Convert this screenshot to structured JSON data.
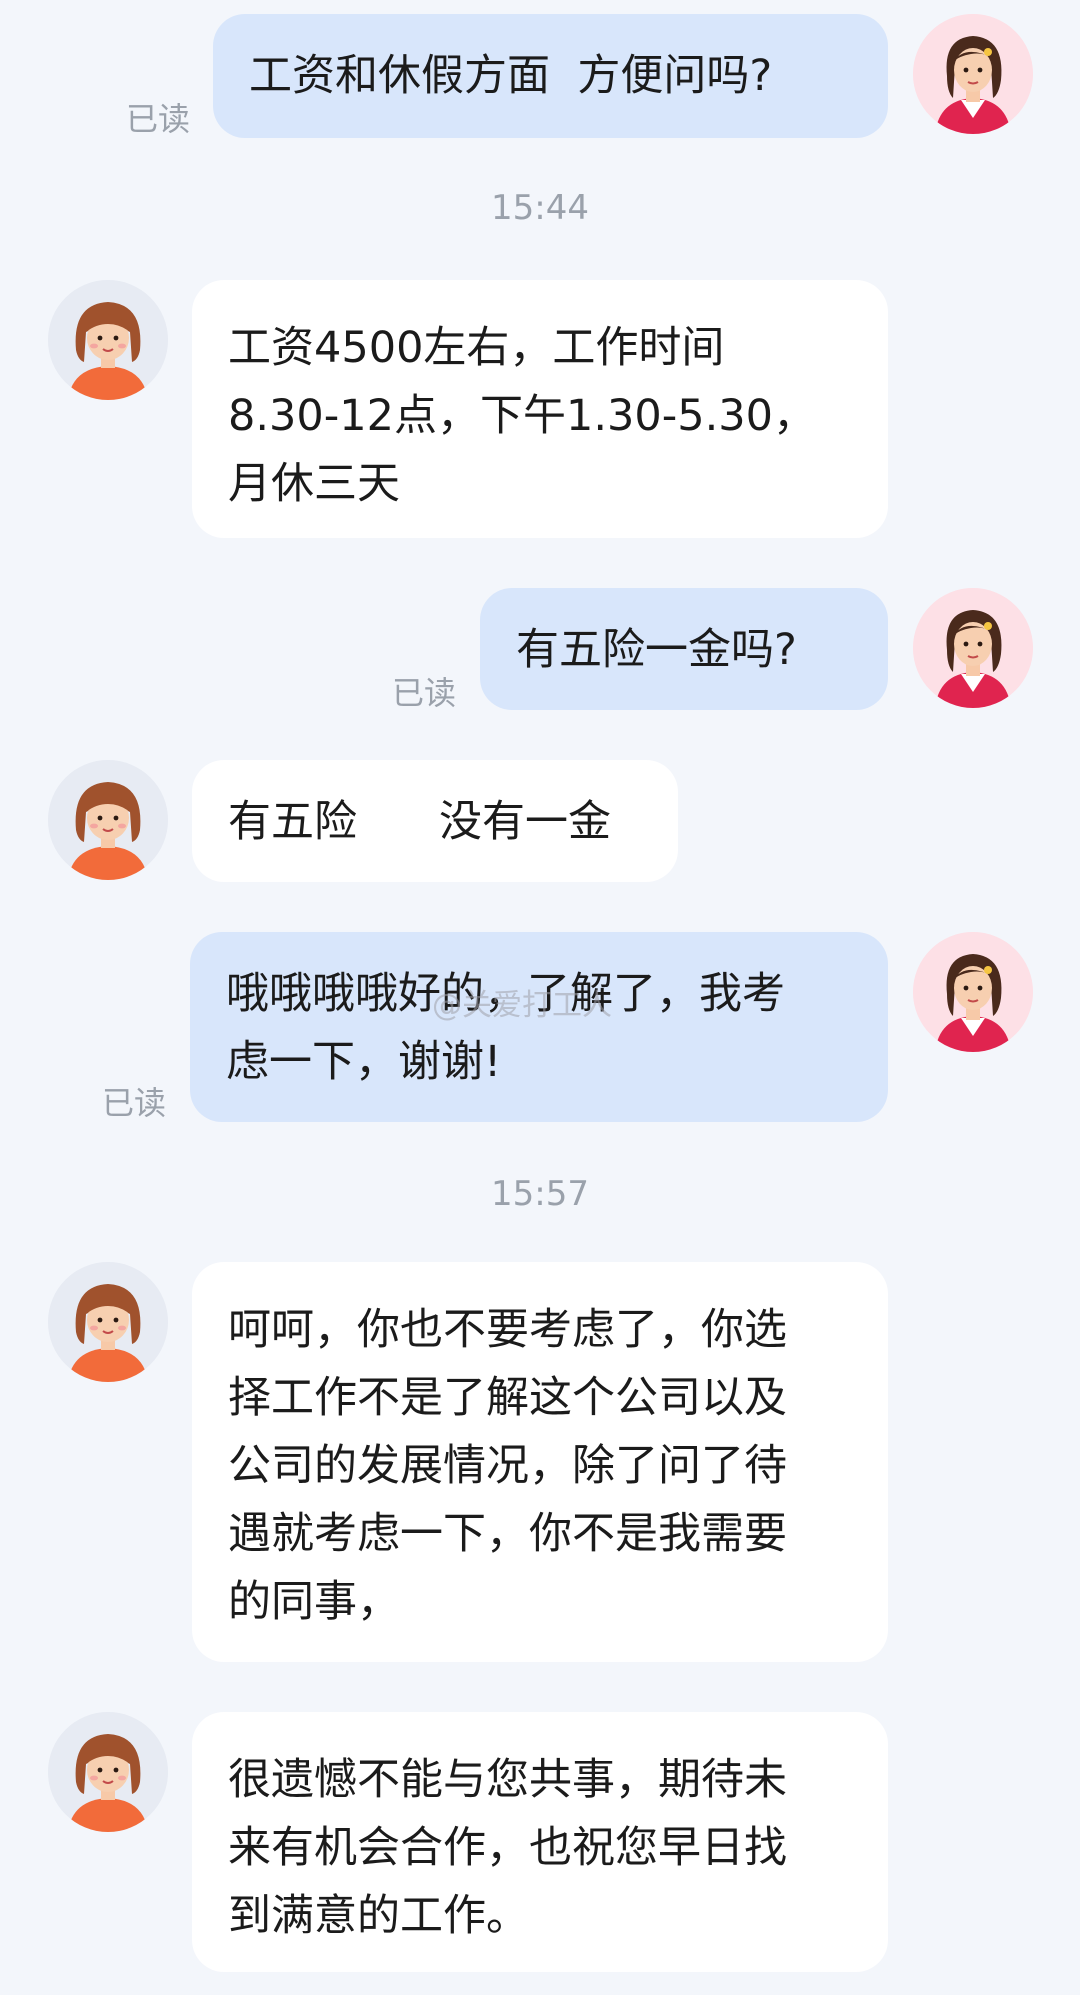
{
  "messages": [
    {
      "text": "工资和休假方面  方便问吗?",
      "read": "已读"
    },
    {
      "time": "15:44"
    },
    {
      "text": "工资4500左右，工作时间\n8.30-12点，下午1.30-5.30，\n月休三天"
    },
    {
      "text": "有五险一金吗?",
      "read": "已读"
    },
    {
      "text": "有五险      没有一金"
    },
    {
      "text": "哦哦哦哦好的，了解了，我考\n虑一下，谢谢!",
      "read": "已读"
    },
    {
      "time": "15:57"
    },
    {
      "text": "呵呵，你也不要考虑了，你选\n择工作不是了解这个公司以及\n公司的发展情况，除了问了待\n遇就考虑一下，你不是我需要\n的同事，"
    },
    {
      "text": "很遗憾不能与您共事，期待未\n来有机会合作，也祝您早日找\n到满意的工作。"
    }
  ],
  "watermark": "@关爱打工人",
  "colors": {
    "background": "#f3f6fb",
    "my_bubble": "#d8e6fb",
    "their_bubble": "#ffffff",
    "muted_text": "#9aa1ab"
  },
  "icons": {
    "my_avatar": "woman-red-jacket-avatar-icon",
    "their_avatar": "woman-orange-shirt-avatar-icon"
  }
}
